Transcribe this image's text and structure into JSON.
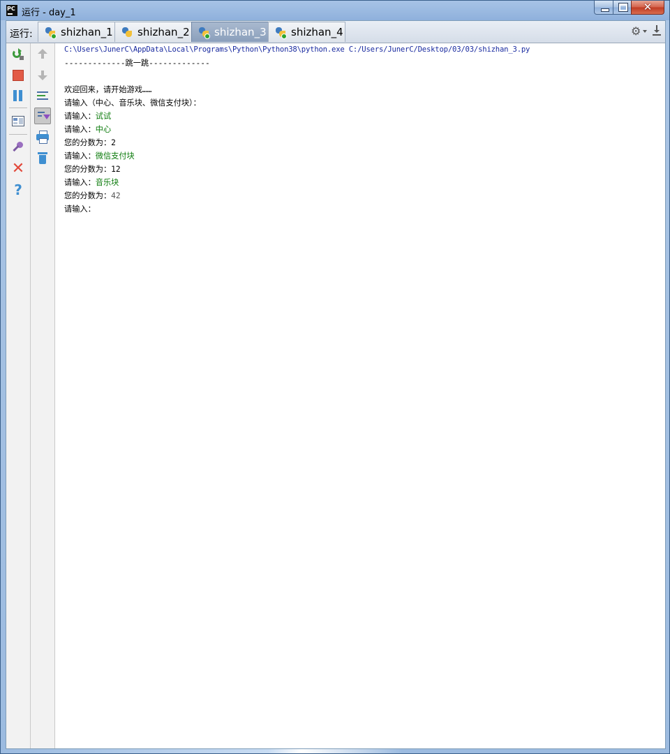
{
  "window": {
    "title": "运行 - day_1",
    "close_glyph": "✕"
  },
  "run_panel": {
    "label": "运行:",
    "tabs": [
      {
        "label": "shizhan_1",
        "active": false
      },
      {
        "label": "shizhan_2",
        "active": false
      },
      {
        "label": "shizhan_3",
        "active": true
      },
      {
        "label": "shizhan_4",
        "active": false
      }
    ]
  },
  "icons": {
    "settings": "⚙",
    "close_red": "✕",
    "help": "?"
  },
  "console": {
    "command": "C:\\Users\\JunerC\\AppData\\Local\\Programs\\Python\\Python38\\python.exe C:/Users/JunerC/Desktop/03/03/shizhan_3.py",
    "header": "-------------跳一跳-------------",
    "welcome": "欢迎回来，请开始游戏……",
    "prompt_options": "请输入（中心、音乐块、微信支付块）：",
    "prompt": "请输入：",
    "score_label": "您的分数为：",
    "entries": [
      {
        "input": "试试"
      },
      {
        "input": "中心",
        "score": "2"
      },
      {
        "input": "微信支付块",
        "score": "12"
      },
      {
        "input": "音乐块",
        "score": "42"
      }
    ],
    "final_prompt": "请输入："
  },
  "colors": {
    "command_text": "#1a2ba0",
    "user_input": "#0a7a0a",
    "console_bg": "#ffffff",
    "active_tab": "#8a9fbb"
  }
}
